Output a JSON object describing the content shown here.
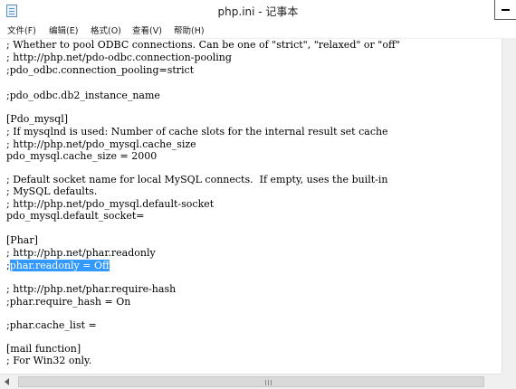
{
  "window": {
    "title": "php.ini - 记事本"
  },
  "menu": [
    "文件(F)",
    "编辑(E)",
    "格式(O)",
    "查看(V)",
    "帮助(H)"
  ],
  "lines": [
    "; Whether to pool ODBC connections. Can be one of \"strict\", \"relaxed\" or \"off\"",
    "; http://php.net/pdo-odbc.connection-pooling",
    ";pdo_odbc.connection_pooling=strict",
    "",
    ";pdo_odbc.db2_instance_name",
    "",
    "[Pdo_mysql]",
    "; If mysqlnd is used: Number of cache slots for the internal result set cache",
    "; http://php.net/pdo_mysql.cache_size",
    "pdo_mysql.cache_size = 2000",
    "",
    "; Default socket name for local MySQL connects.  If empty, uses the built-in",
    "; MySQL defaults.",
    "; http://php.net/pdo_mysql.default-socket",
    "pdo_mysql.default_socket=",
    "",
    "[Phar]",
    "; http://php.net/phar.readonly",
    ";phar.readonly = Off",
    "",
    "; http://php.net/phar.require-hash",
    ";phar.require_hash = On",
    "",
    ";phar.cache_list =",
    "",
    "[mail function]",
    "; For Win32 only."
  ],
  "selection": {
    "prefix": ";",
    "selected": "phar.readonly = Off"
  },
  "colors": {
    "selection_bg": "#3399ff",
    "selection_text": "#ffffff"
  }
}
